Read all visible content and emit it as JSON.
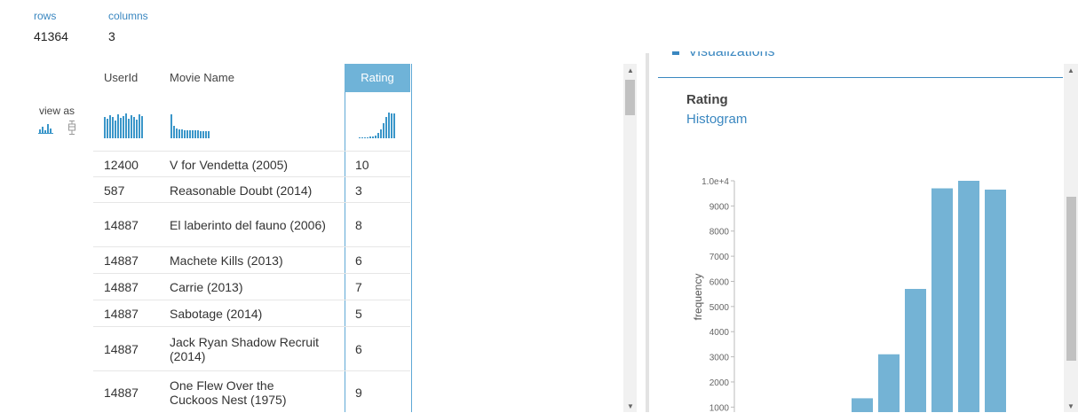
{
  "stats": {
    "rows_label": "rows",
    "rows_value": "41364",
    "columns_label": "columns",
    "columns_value": "3"
  },
  "view_as_label": "view as",
  "columns": [
    "UserId",
    "Movie Name",
    "Rating"
  ],
  "rows": [
    {
      "user": "12400",
      "movie": "V for Vendetta (2005)",
      "rating": "10"
    },
    {
      "user": "587",
      "movie": "Reasonable Doubt (2014)",
      "rating": "3"
    },
    {
      "user": "14887",
      "movie": "El laberinto del fauno (2006)",
      "rating": "8"
    },
    {
      "user": "14887",
      "movie": "Machete Kills (2013)",
      "rating": "6"
    },
    {
      "user": "14887",
      "movie": "Carrie (2013)",
      "rating": "7"
    },
    {
      "user": "14887",
      "movie": "Sabotage (2014)",
      "rating": "5"
    },
    {
      "user": "14887",
      "movie": "Jack Ryan Shadow Recruit (2014)",
      "rating": "6"
    },
    {
      "user": "14887",
      "movie": "One Flew Over the Cuckoos Nest (1975)",
      "rating": "9"
    }
  ],
  "panel": {
    "section_title": "Visualizations",
    "column_name": "Rating",
    "chart_kind": "Histogram"
  },
  "colors": {
    "accent": "#6fb3d8",
    "link": "#3a87c0",
    "bar": "#74b3d5"
  },
  "chart_data": {
    "type": "bar",
    "ylabel": "frequency",
    "yticks": [
      "1000",
      "2000",
      "3000",
      "4000",
      "5000",
      "6000",
      "7000",
      "8000",
      "9000",
      "1.0e+4"
    ],
    "ylim": [
      800,
      10000
    ],
    "values": [
      1350,
      3100,
      5700,
      9700,
      10000,
      9650
    ]
  }
}
